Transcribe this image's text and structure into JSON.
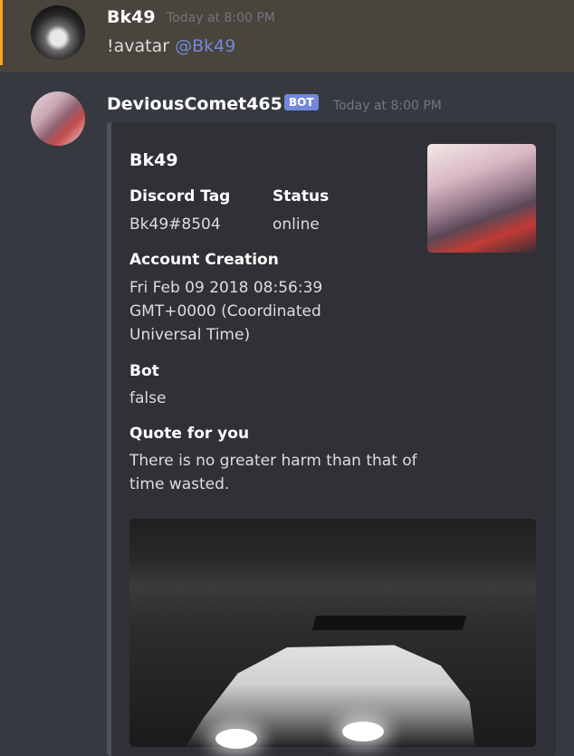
{
  "messages": [
    {
      "username": "Bk49",
      "timestamp": "Today at 8:00 PM",
      "text": "!avatar ",
      "mention": "@Bk49"
    },
    {
      "username": "DeviousComet465",
      "badge": "BOT",
      "timestamp": "Today at 8:00 PM"
    }
  ],
  "embed": {
    "title": "Bk49",
    "fields": [
      {
        "name": "Discord Tag",
        "value": "Bk49#8504"
      },
      {
        "name": "Status",
        "value": "online"
      },
      {
        "name": "Account Creation",
        "value": "Fri Feb 09 2018 08:56:39 GMT+0000 (Coordinated Universal Time)"
      },
      {
        "name": "Bot",
        "value": "false"
      },
      {
        "name": "Quote for you",
        "value": "There is no greater harm than that of time wasted."
      }
    ]
  },
  "colors": {
    "mention_bar": "#faa61a",
    "mention_bg": "#49443c",
    "bot_badge": "#7289da",
    "embed_bg": "#2f3136",
    "mention_text": "#7289da"
  }
}
